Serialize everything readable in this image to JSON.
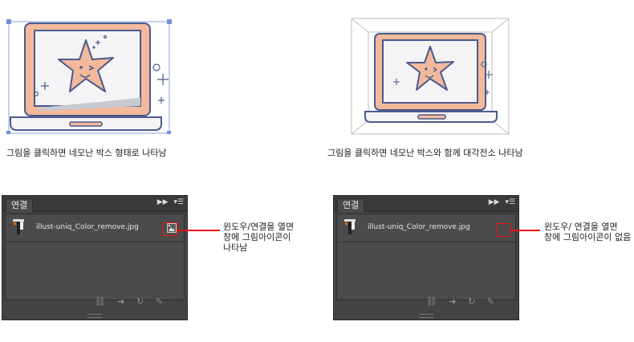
{
  "top_left": {
    "caption": "그림을 클릭하면 네모난 박스 형태로 나타남"
  },
  "top_right": {
    "caption": "그림을 클릭하면 네모난 박스와 함께 대각전소 나타남"
  },
  "panel_left": {
    "tab": "연결",
    "file": "illust-uniq_Color_remove.jpg",
    "note_lines": [
      "윈도우/연결을 열면",
      "창에 그림아이콘이",
      "나타남"
    ]
  },
  "panel_right": {
    "tab": "연결",
    "file": "illust-uniq_Color_remove.jpg",
    "note_lines": [
      "윈도우/ 연결을 열면",
      "창에 그림아이콘이 없음"
    ]
  },
  "colors": {
    "skin": "#f2b99c",
    "outline": "#4a5a8c",
    "accent_red": "#e11111",
    "panel_bg": "#434343"
  },
  "icons": [
    "play-forward-icon",
    "panel-menu-icon",
    "relink-icon",
    "goto-link-icon",
    "update-link-icon",
    "edit-original-icon",
    "image-thumbnail-icon"
  ]
}
